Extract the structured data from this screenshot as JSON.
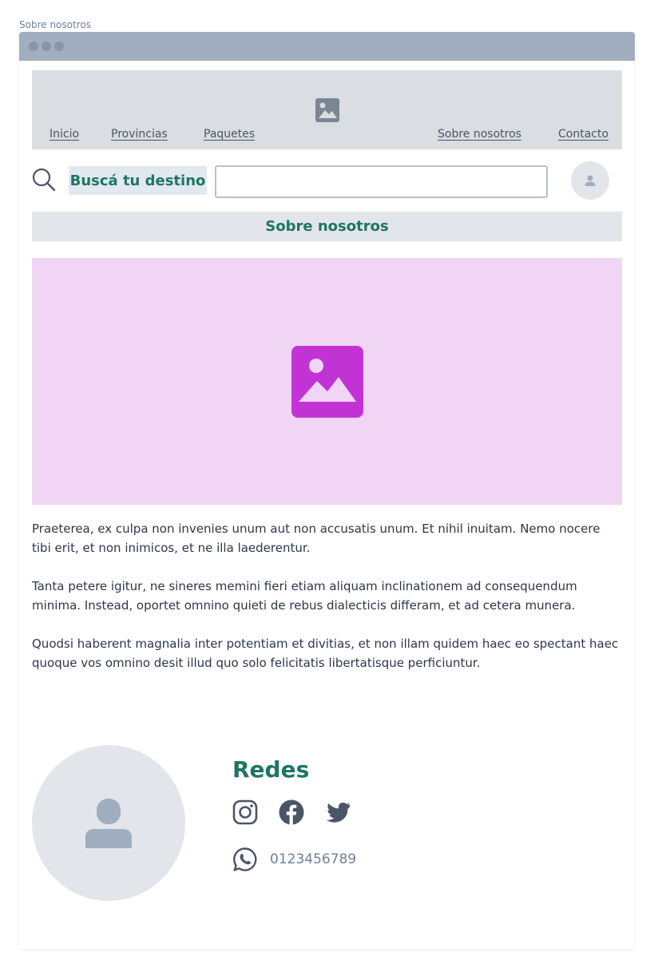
{
  "page_label": "Sobre nosotros",
  "nav": {
    "links": [
      "Inicio",
      "Provincias",
      "Paquetes",
      "Sobre nosotros",
      "Contacto"
    ],
    "logo_icon": "image-icon"
  },
  "search": {
    "label": "Buscá tu destino",
    "value": "",
    "placeholder": ""
  },
  "section_title": "Sobre nosotros",
  "hero": {
    "icon": "image-icon",
    "color": "#c233d6"
  },
  "paragraphs": [
    "Praeterea, ex culpa non invenies unum aut non accusatis unum. Et nihil inuitam. Nemo nocere tibi erit, et non inimicos, et ne illa laederentur.",
    "Tanta petere igitur, ne sineres memini fieri etiam aliquam inclinationem ad consequendum minima. Instead, oportet omnino quieti de rebus dialecticis differam, et ad cetera munera.",
    "Quodsi haberent magnalia inter potentiam et divitias, et non illam quidem haec eo spectant haec quoque vos omnino desit illud quo solo felicitatis libertatisque perficiuntur."
  ],
  "footer": {
    "title": "Redes",
    "social": [
      "instagram-icon",
      "facebook-icon",
      "twitter-icon"
    ],
    "phone": "0123456789"
  },
  "colors": {
    "accent": "#1e7562",
    "hero_bg": "#f0d5f4",
    "nav_bg": "#dadde1"
  }
}
